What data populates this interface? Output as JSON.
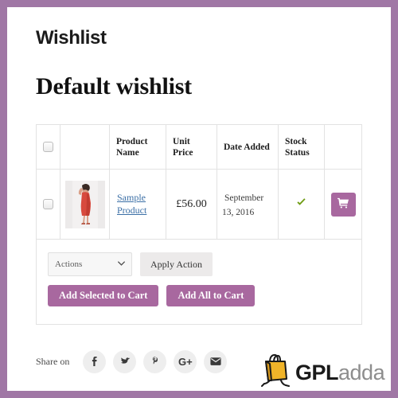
{
  "theme": {
    "frame_color": "#a077a5",
    "accent_purple": "#a8689f",
    "link_blue": "#3b6fa6",
    "stock_green": "#6f9c14",
    "button_gray": "#eceaea"
  },
  "page": {
    "title": "Wishlist",
    "wishlist_name": "Default wishlist"
  },
  "table": {
    "headers": {
      "select_all": "",
      "thumbnail": "",
      "product_name": "Product Name",
      "unit_price": "Unit Price",
      "date_added": "Date Added",
      "stock_status": "Stock Status",
      "actions": ""
    },
    "rows": [
      {
        "selected": false,
        "thumbnail_alt": "Sample Product thumbnail - model wearing red dress",
        "product_name": "Sample Product",
        "unit_price": "£56.00",
        "date_added": "September 13, 2016",
        "stock_status_icon": "check-icon",
        "stock_status_label": "✔",
        "add_to_cart_icon": "shopping-cart-icon"
      }
    ]
  },
  "bulk_actions": {
    "select_value": "Actions",
    "select_options": [
      "Actions"
    ],
    "chevron": "⌄",
    "apply_label": "Apply Action",
    "add_selected_label": "Add Selected to Cart",
    "add_all_label": "Add All to Cart"
  },
  "share": {
    "label": "Share on",
    "icons": [
      {
        "name": "facebook-icon",
        "glyph": "f"
      },
      {
        "name": "twitter-icon",
        "glyph": "t"
      },
      {
        "name": "pinterest-icon",
        "glyph": "p"
      },
      {
        "name": "google-plus-icon",
        "glyph": "G+"
      },
      {
        "name": "email-icon",
        "glyph": "m"
      }
    ]
  },
  "brand": {
    "name_bold": "GPL",
    "name_light": "adda",
    "logo_icon": "shopping-bag-icon"
  }
}
